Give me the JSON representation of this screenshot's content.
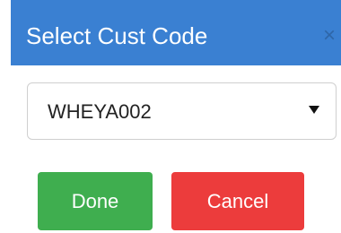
{
  "dialog": {
    "title": "Select Cust Code",
    "close_icon": "close-icon",
    "select": {
      "selected_value": "WHEYA002",
      "chevron_icon": "chevron-down-icon"
    },
    "buttons": {
      "done_label": "Done",
      "cancel_label": "Cancel"
    },
    "colors": {
      "header": "#3a80d2",
      "done": "#3fae4f",
      "cancel": "#ec3c3c"
    }
  }
}
